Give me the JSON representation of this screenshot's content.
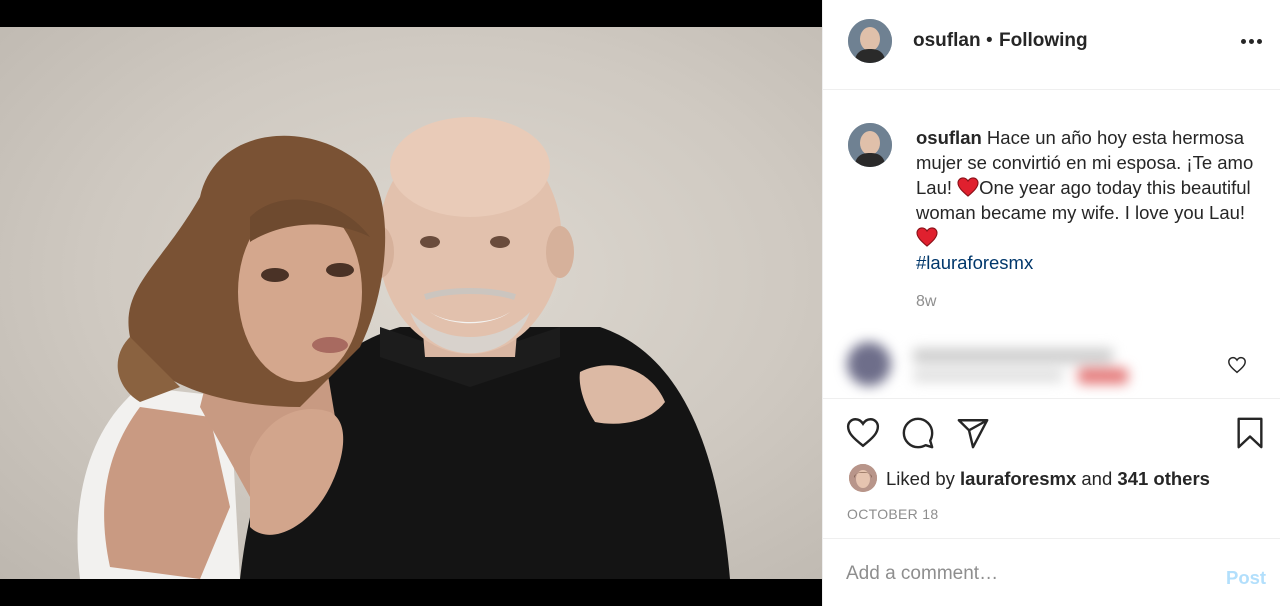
{
  "post": {
    "username": "osuflan",
    "separator": "•",
    "follow_status": "Following",
    "caption_parts": [
      "Hace un año hoy esta hermosa mujer se convirtió en mi esposa. ¡Te amo Lau! ",
      "One year ago today this beautiful woman became my wife. I love you Lau! "
    ],
    "hashtag": "#lauraforesmx",
    "time_ago": "8w",
    "likes": {
      "prefix": "Liked by ",
      "liker": "lauraforesmx",
      "joiner": " and ",
      "others": "341 others"
    },
    "date": "OCTOBER 18"
  },
  "comment_box": {
    "placeholder": "Add a comment…",
    "post_label": "Post"
  },
  "colors": {
    "heart": "#ed4956",
    "hashtag": "#00376b",
    "post_button_disabled": "#b2dffc",
    "muted_text": "#8e8e8e"
  },
  "icons": [
    "more-options-icon",
    "heart-emoji-icon",
    "like-icon",
    "comment-icon",
    "share-icon",
    "save-icon",
    "comment-like-icon"
  ]
}
